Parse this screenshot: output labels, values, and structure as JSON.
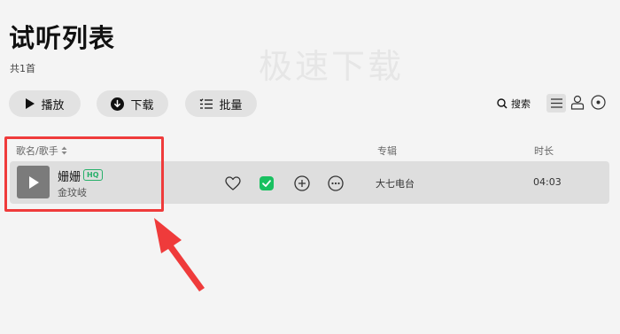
{
  "header": {
    "title": "试听列表",
    "count": "共1首",
    "watermark": "极速下载"
  },
  "toolbar": {
    "play_label": "播放",
    "download_label": "下载",
    "batch_label": "批量",
    "search_label": "搜索"
  },
  "table": {
    "columns": {
      "name": "歌名/歌手",
      "album": "专辑",
      "duration": "时长"
    },
    "rows": [
      {
        "title": "姗姗",
        "quality": "HQ",
        "artist": "金玟岐",
        "album": "大七电台",
        "duration": "04:03"
      }
    ]
  },
  "colors": {
    "background": "#f4f4f4",
    "button": "#e2e2e2",
    "row": "#dedede",
    "accent_green": "#27b06a",
    "annotation_red": "#ef3b3b"
  },
  "icons": [
    "play-icon",
    "download-icon",
    "batch-icon",
    "search-icon",
    "list-view-icon",
    "artist-view-icon",
    "album-view-icon",
    "sort-icon",
    "heart-icon",
    "check-icon",
    "add-icon",
    "more-icon"
  ]
}
